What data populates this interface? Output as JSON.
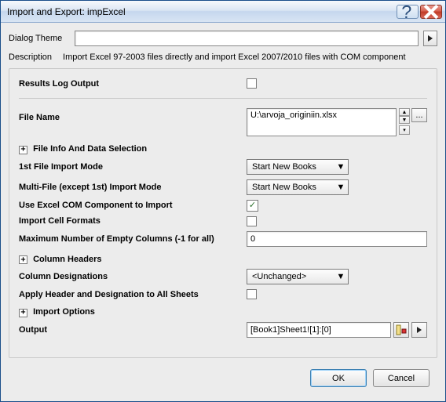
{
  "titlebar": {
    "title": "Import and Export: impExcel"
  },
  "dialog_theme": {
    "label": "Dialog Theme",
    "value": ""
  },
  "description": {
    "label": "Description",
    "text": "Import Excel 97-2003 files directly and import Excel 2007/2010 files with COM component"
  },
  "group": {
    "results_log_output": {
      "label": "Results Log Output",
      "checked": false
    },
    "file_name": {
      "label": "File Name",
      "value": "U:\\arvoja_originiin.xlsx"
    },
    "file_info_selection": {
      "label": "File Info And Data Selection"
    },
    "first_file_import_mode": {
      "label": "1st File Import Mode",
      "value": "Start New Books"
    },
    "multi_file_import_mode": {
      "label": "Multi-File (except 1st) Import Mode",
      "value": "Start New Books"
    },
    "use_com": {
      "label": "Use Excel COM Component to Import",
      "checked": true
    },
    "import_cell_formats": {
      "label": "Import Cell Formats",
      "checked": false
    },
    "max_empty_cols": {
      "label": "Maximum Number of Empty Columns (-1 for all)",
      "value": "0"
    },
    "column_headers": {
      "label": "Column Headers"
    },
    "column_designations": {
      "label": "Column Designations",
      "value": "<Unchanged>"
    },
    "apply_header_all": {
      "label": "Apply Header and Designation to All Sheets",
      "checked": false
    },
    "import_options": {
      "label": "Import Options"
    },
    "output": {
      "label": "Output",
      "value": "[Book1]Sheet1![1]:[0]"
    }
  },
  "footer": {
    "ok": "OK",
    "cancel": "Cancel"
  },
  "glyphs": {
    "plus": "+",
    "check": "✓",
    "ellipsis": "...",
    "up": "▲",
    "down": "▼",
    "right": "▶"
  }
}
